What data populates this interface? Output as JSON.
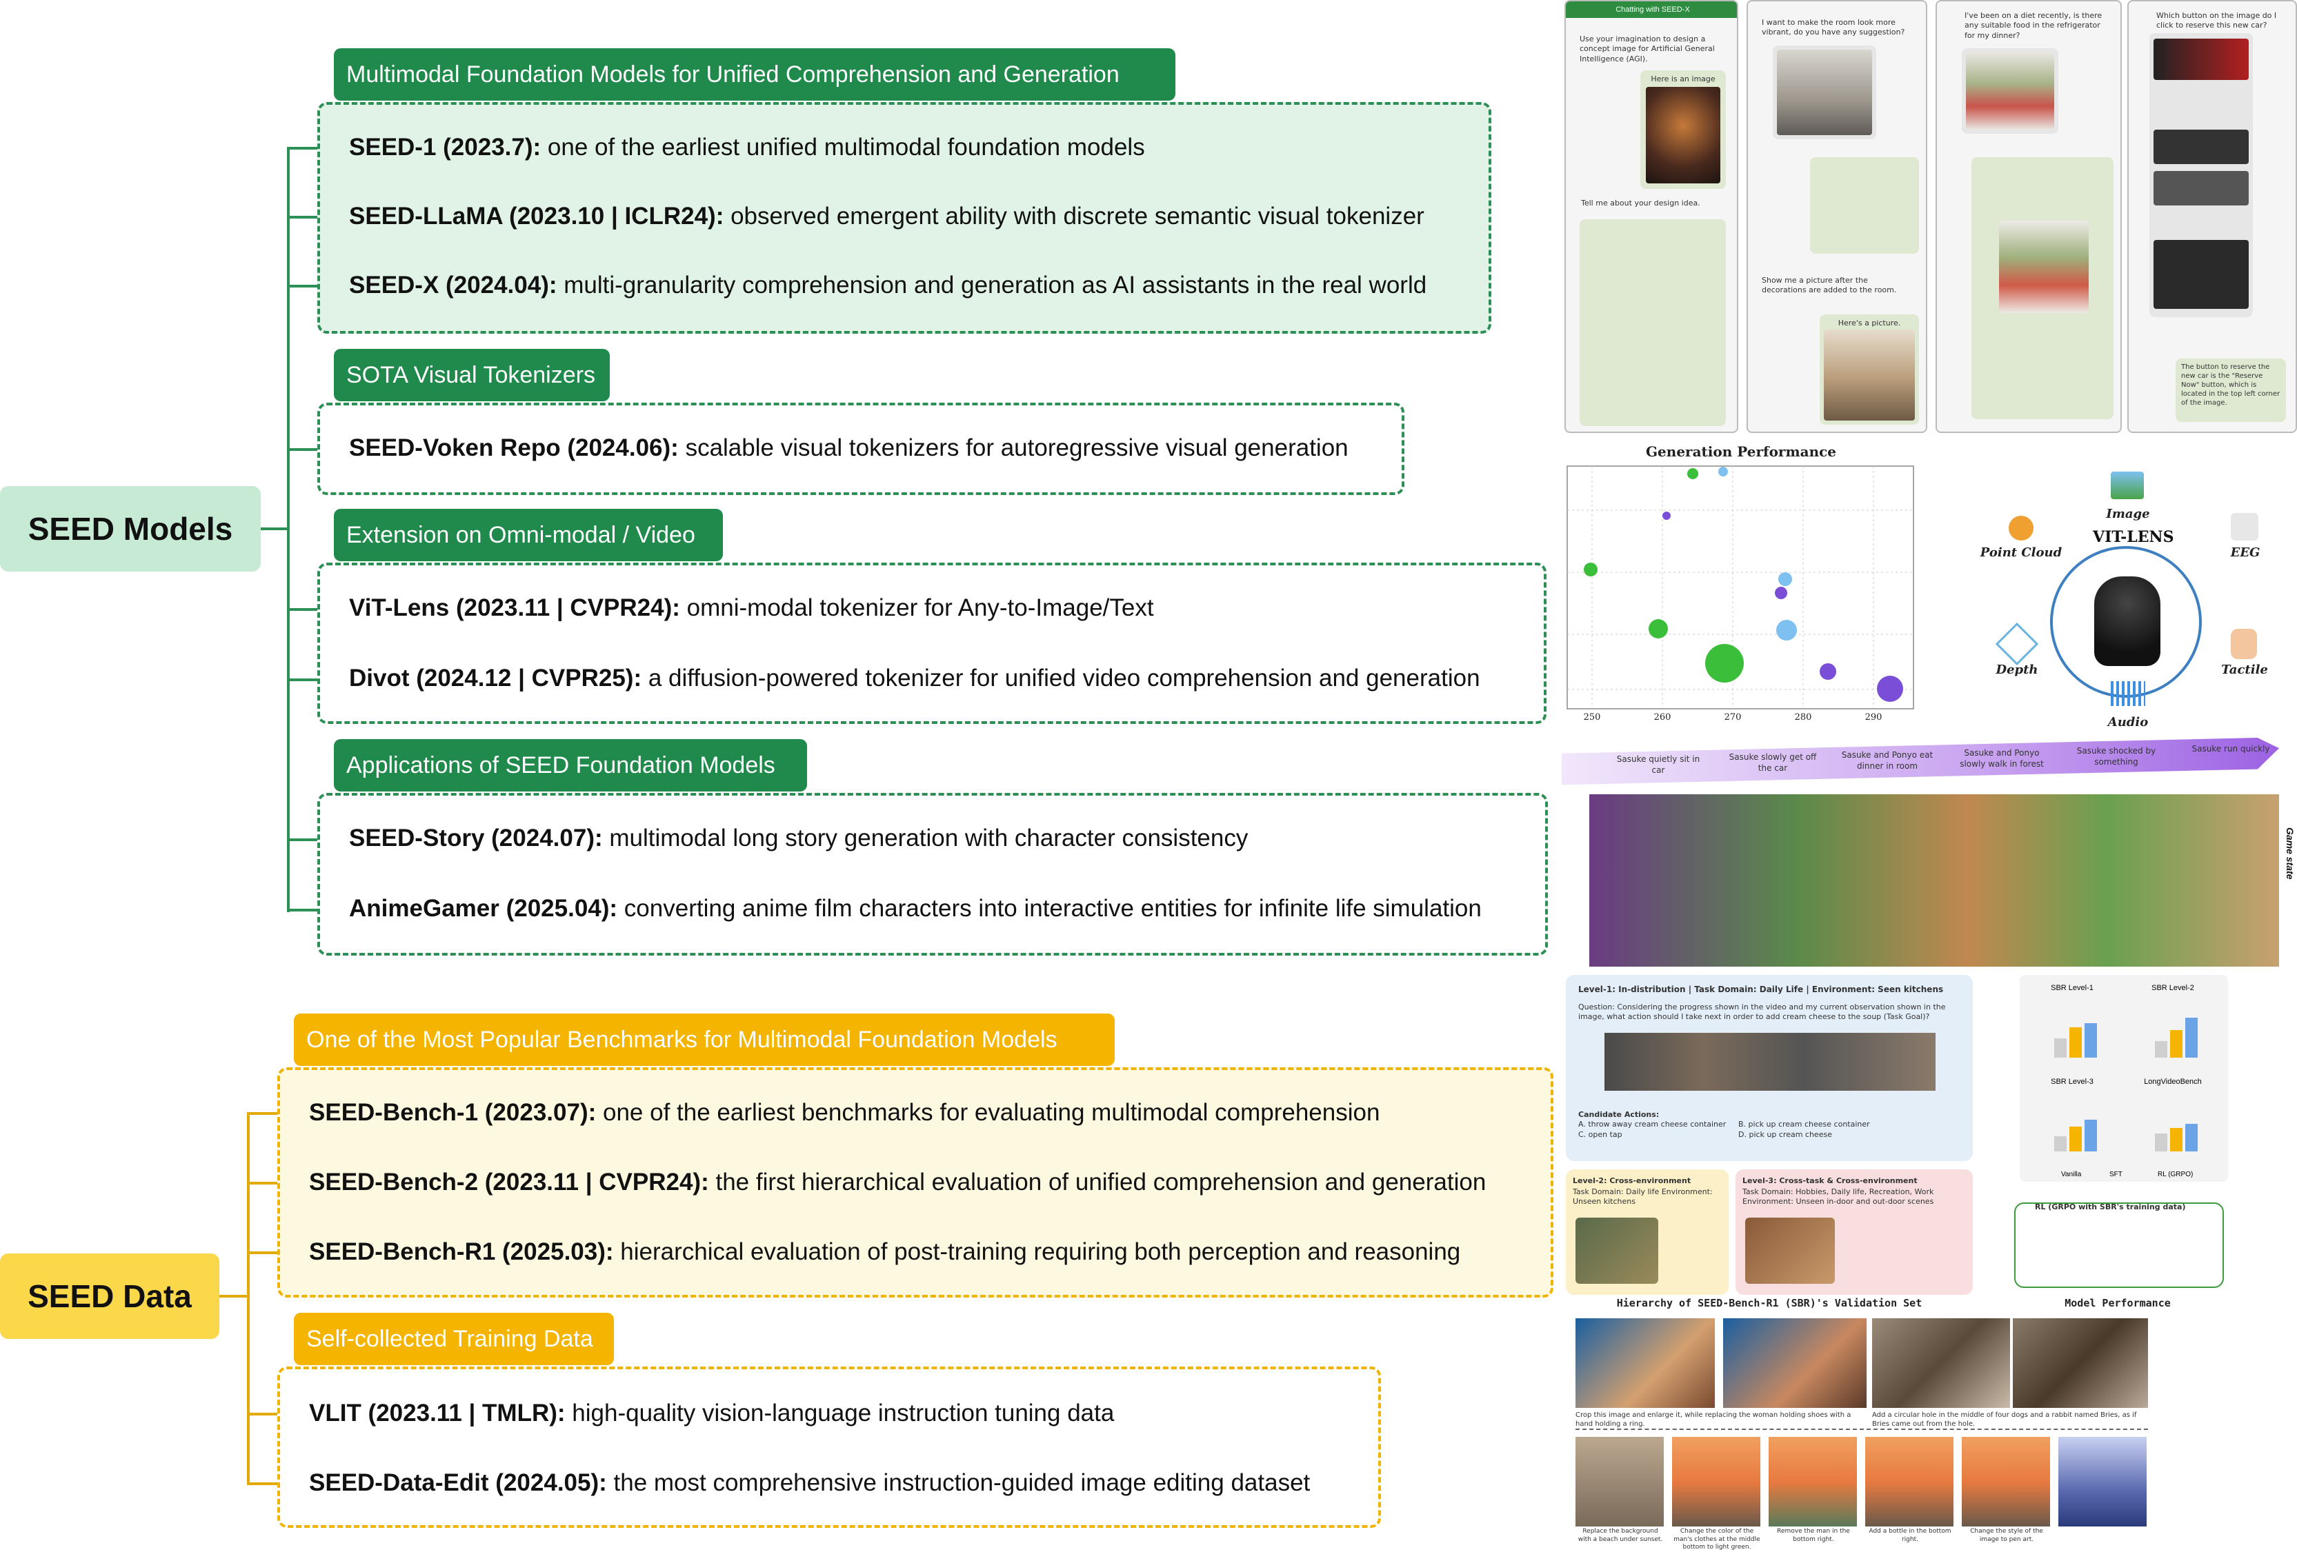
{
  "roots": {
    "models": "SEED Models",
    "data": "SEED Data"
  },
  "models": {
    "sec1": {
      "header": "Multimodal Foundation Models for Unified Comprehension and Generation",
      "items": [
        {
          "name": "SEED-1 (2023.7):",
          "desc": " one of the earliest unified multimodal foundation models"
        },
        {
          "name": "SEED-LLaMA (2023.10 | ICLR24):",
          "desc": " observed emergent ability with discrete semantic visual tokenizer"
        },
        {
          "name": "SEED-X (2024.04):",
          "desc": " multi-granularity comprehension and generation as AI assistants in the real world"
        }
      ]
    },
    "sec2": {
      "header": "SOTA Visual Tokenizers",
      "items": [
        {
          "name": "SEED-Voken Repo (2024.06):",
          "desc": " scalable visual tokenizers for autoregressive visual generation"
        }
      ]
    },
    "sec3": {
      "header": "Extension on Omni-modal / Video",
      "items": [
        {
          "name": "ViT-Lens (2023.11 | CVPR24):",
          "desc": " omni-modal tokenizer for Any-to-Image/Text"
        },
        {
          "name": "Divot (2024.12 | CVPR25):",
          "desc": " a diffusion-powered tokenizer for unified video comprehension and generation"
        }
      ]
    },
    "sec4": {
      "header": "Applications of SEED Foundation Models",
      "items": [
        {
          "name": "SEED-Story (2024.07):",
          "desc": " multimodal long story generation with character consistency"
        },
        {
          "name": "AnimeGamer (2025.04):",
          "desc": " converting anime film characters into interactive entities for infinite life simulation"
        }
      ]
    }
  },
  "data": {
    "sec1": {
      "header": "One of the Most Popular Benchmarks for Multimodal Foundation Models",
      "items": [
        {
          "name": "SEED-Bench-1 (2023.07):",
          "desc": " one of the earliest benchmarks for evaluating multimodal comprehension"
        },
        {
          "name": "SEED-Bench-2 (2023.11 | CVPR24):",
          "desc": " the first hierarchical evaluation of unified comprehension and generation"
        },
        {
          "name": "SEED-Bench-R1 (2025.03):",
          "desc": " hierarchical evaluation of post-training requiring both perception and reasoning"
        }
      ]
    },
    "sec2": {
      "header": "Self-collected Training Data",
      "items": [
        {
          "name": "VLIT (2023.11 | TMLR):",
          "desc": " high-quality vision-language instruction tuning data"
        },
        {
          "name": "SEED-Data-Edit (2024.05):",
          "desc": " the most comprehensive instruction-guided image editing dataset"
        }
      ]
    }
  },
  "right": {
    "chat": {
      "title": "Chatting with SEED-X",
      "p1_user": "Use your imagination to design a concept image for Artificial General Intelligence (AGI).",
      "p1_bot1": "Here is an image",
      "p1_user2": "Tell me about your design idea.",
      "p2_user": "I want to make the room look more vibrant, do you have any suggestion?",
      "p2_user2": "Show me a picture after the decorations are added to the room.",
      "p2_bot2": "Here's a picture.",
      "p3_user": "I've been on a diet recently, is there any suitable food in the refrigerator for my dinner?",
      "p4_user": "Which button on the image do I click to reserve this new car?",
      "p4_bot": "The button to reserve the new car is the \"Reserve Now\" button, which is located in the top left corner of the image."
    },
    "chart": {
      "title": "Generation Performance",
      "xticks": [
        "250",
        "260",
        "270",
        "280",
        "290"
      ]
    },
    "vitlens": {
      "title": "VIT-LENS",
      "modalities": [
        "Image",
        "Point Cloud",
        "EEG",
        "Depth",
        "Tactile",
        "Audio"
      ]
    },
    "story": {
      "steps": [
        "Sasuke quietly sit in car",
        "Sasuke slowly get off the car",
        "Sasuke and Ponyo eat dinner in room",
        "Sasuke and Ponyo slowly walk in forest",
        "Sasuke shocked by something",
        "Sasuke run quickly"
      ],
      "side": "Game state"
    },
    "bench": {
      "level1": "Level-1: In-distribution | Task Domain: Daily Life | Environment: Seen kitchens",
      "question": "Question: Considering the progress shown in the video and my current observation shown in the image, what action should I take next in order to add cream cheese to the soup (Task Goal)?",
      "candidates": "Candidate Actions:",
      "opts": [
        "A. throw away cream cheese container",
        "B. pick up cream cheese container",
        "C. open tap",
        "D. pick up cream cheese"
      ],
      "level2": "Level-2: Cross-environment",
      "level2b": "Task Domain: Daily life  Environment: Unseen kitchens",
      "level3": "Level-3: Cross-task & Cross-environment",
      "level3b": "Task Domain: Hobbies, Daily life, Recreation, Work  Environment: Unseen in-door and out-door scenes",
      "caption": "Hierarchy of SEED-Bench-R1 (SBR)'s Validation Set",
      "perf": "Model Performance",
      "bars": [
        "SBR Level-1",
        "SBR Level-2",
        "SBR Level-3",
        "LongVideoBench"
      ],
      "legend": [
        "Vanilla",
        "SFT",
        "RL (GRPO)"
      ],
      "rl": "RL (GRPO with SBR's training data)"
    },
    "edit": {
      "c1": "Crop this image and enlarge it, while replacing the woman holding shoes with a hand holding a ring.",
      "c2": "Add a circular hole in the middle of four dogs and a rabbit named Bries, as if Bries came out from the hole.",
      "c3": [
        "Replace the background with a beach under sunset.",
        "Change the color of the man's clothes at the middle bottom to light green.",
        "Remove the man in the bottom right.",
        "Add a bottle in the bottom right.",
        "Change the style of the image to pen art."
      ]
    }
  }
}
